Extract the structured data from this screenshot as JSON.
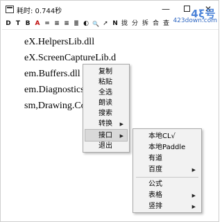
{
  "window": {
    "title": "耗时: 0.744秒",
    "controls": {
      "minimize": "—",
      "close": "✕"
    }
  },
  "watermark": {
    "logo": "4ξ号",
    "url": "423down.com"
  },
  "toolbar": {
    "buttons": [
      "D",
      "T",
      "B",
      "A",
      "=",
      "≡",
      "≡",
      "≣",
      "◐",
      "🔍",
      "➚",
      "N",
      "拢",
      "分",
      "拆",
      "合",
      "查"
    ]
  },
  "editor": {
    "lines": [
      "eX.HelpersLib.dll",
      "eX.ScreenCaptureLib.d",
      "em.Buffers.dll",
      "em.Diagnostics.D",
      "sm,Drawing.Com"
    ]
  },
  "context_menu": {
    "items": [
      {
        "label": "复制"
      },
      {
        "label": "粘贴"
      },
      {
        "label": "全选"
      },
      {
        "label": "朗读"
      },
      {
        "label": "搜索"
      },
      {
        "label": "转换",
        "submenu": true
      },
      {
        "label": "接口",
        "submenu": true,
        "active": true
      },
      {
        "label": "退出"
      }
    ]
  },
  "submenu": {
    "group1": [
      {
        "label": "本地CL√"
      },
      {
        "label": "本地Paddle"
      },
      {
        "label": "有道"
      },
      {
        "label": "百度",
        "submenu": true
      }
    ],
    "group2": [
      {
        "label": "公式"
      },
      {
        "label": "表格",
        "submenu": true
      },
      {
        "label": "竖排",
        "submenu": true
      }
    ]
  }
}
